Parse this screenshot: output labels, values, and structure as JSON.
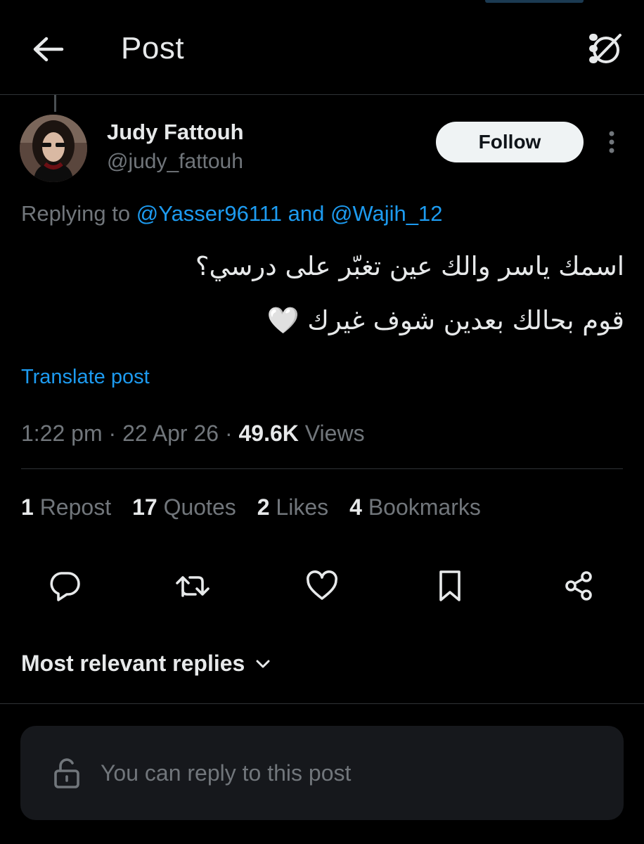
{
  "header": {
    "title": "Post",
    "back_icon": "arrow-left-icon",
    "menu_icon": "grok-icon"
  },
  "author": {
    "name": "Judy Fattouh",
    "handle": "@judy_fattouh",
    "follow_label": "Follow"
  },
  "post": {
    "replying_prefix": "Replying to",
    "replying_user_1": "@Yasser96111",
    "replying_joiner": "and",
    "replying_user_2": "@Wajih_12",
    "line_1": "اسمك ياسر والك عين تغبّر على درسي؟",
    "line_2": "قوم بحالك بعدين شوف غيرك 🤍",
    "translate_label": "Translate post",
    "time": "1:22 pm",
    "date": "22 Apr 26",
    "views_count": "49.6K",
    "views_label": "Views",
    "separator": "·"
  },
  "stats": [
    {
      "count": "1",
      "label": "Repost"
    },
    {
      "count": "17",
      "label": "Quotes"
    },
    {
      "count": "2",
      "label": "Likes"
    },
    {
      "count": "4",
      "label": "Bookmarks"
    }
  ],
  "replies": {
    "sort_label": "Most relevant replies",
    "input_placeholder": "You can reply to this post"
  },
  "colors": {
    "background": "#000000",
    "text": "#e7e9ea",
    "muted": "#71767b",
    "link": "#1d9bf0",
    "divider": "#2f3336",
    "follow_bg": "#eff3f4",
    "reply_box_bg": "#16181c"
  }
}
